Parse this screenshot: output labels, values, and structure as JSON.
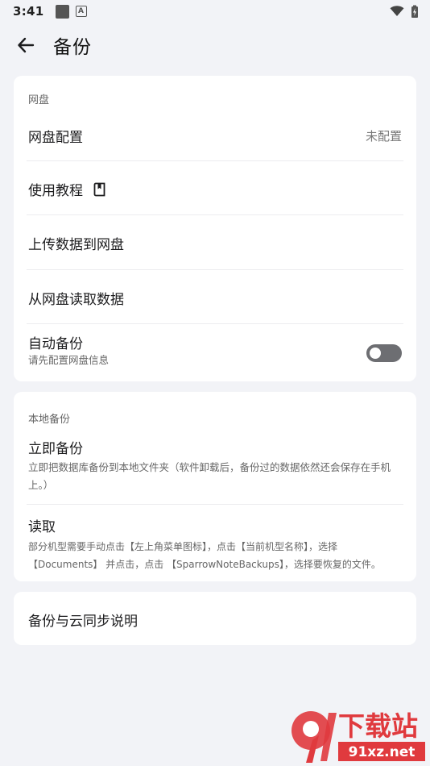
{
  "status_bar": {
    "time": "3:41",
    "a_badge": "A"
  },
  "header": {
    "title": "备份",
    "back_icon": "arrow-left-icon"
  },
  "cloud_section": {
    "label": "网盘",
    "config": {
      "label": "网盘配置",
      "value": "未配置"
    },
    "tutorial": {
      "label": "使用教程",
      "icon": "book-icon"
    },
    "upload": {
      "label": "上传数据到网盘"
    },
    "download": {
      "label": "从网盘读取数据"
    },
    "auto_backup": {
      "label": "自动备份",
      "subtitle": "请先配置网盘信息",
      "enabled": false
    }
  },
  "local_section": {
    "label": "本地备份",
    "backup_now": {
      "label": "立即备份",
      "subtitle": "立即把数据库备份到本地文件夹（软件卸载后，备份过的数据依然还会保存在手机上。）"
    },
    "restore": {
      "label": "读取",
      "subtitle": "部分机型需要手动点击【左上角菜单图标】，点击【当前机型名称】，选择【Documents】 并点击，点击 【SparrowNoteBackups】，选择要恢复的文件。"
    }
  },
  "info_section": {
    "label": "备份与云同步说明"
  },
  "watermark": {
    "big": "下载站",
    "small": "91xz.net"
  },
  "colors": {
    "background": "#f2f3f7",
    "card": "#ffffff",
    "toggle_off": "#6d6e72",
    "watermark_red": "#e03a3e"
  }
}
